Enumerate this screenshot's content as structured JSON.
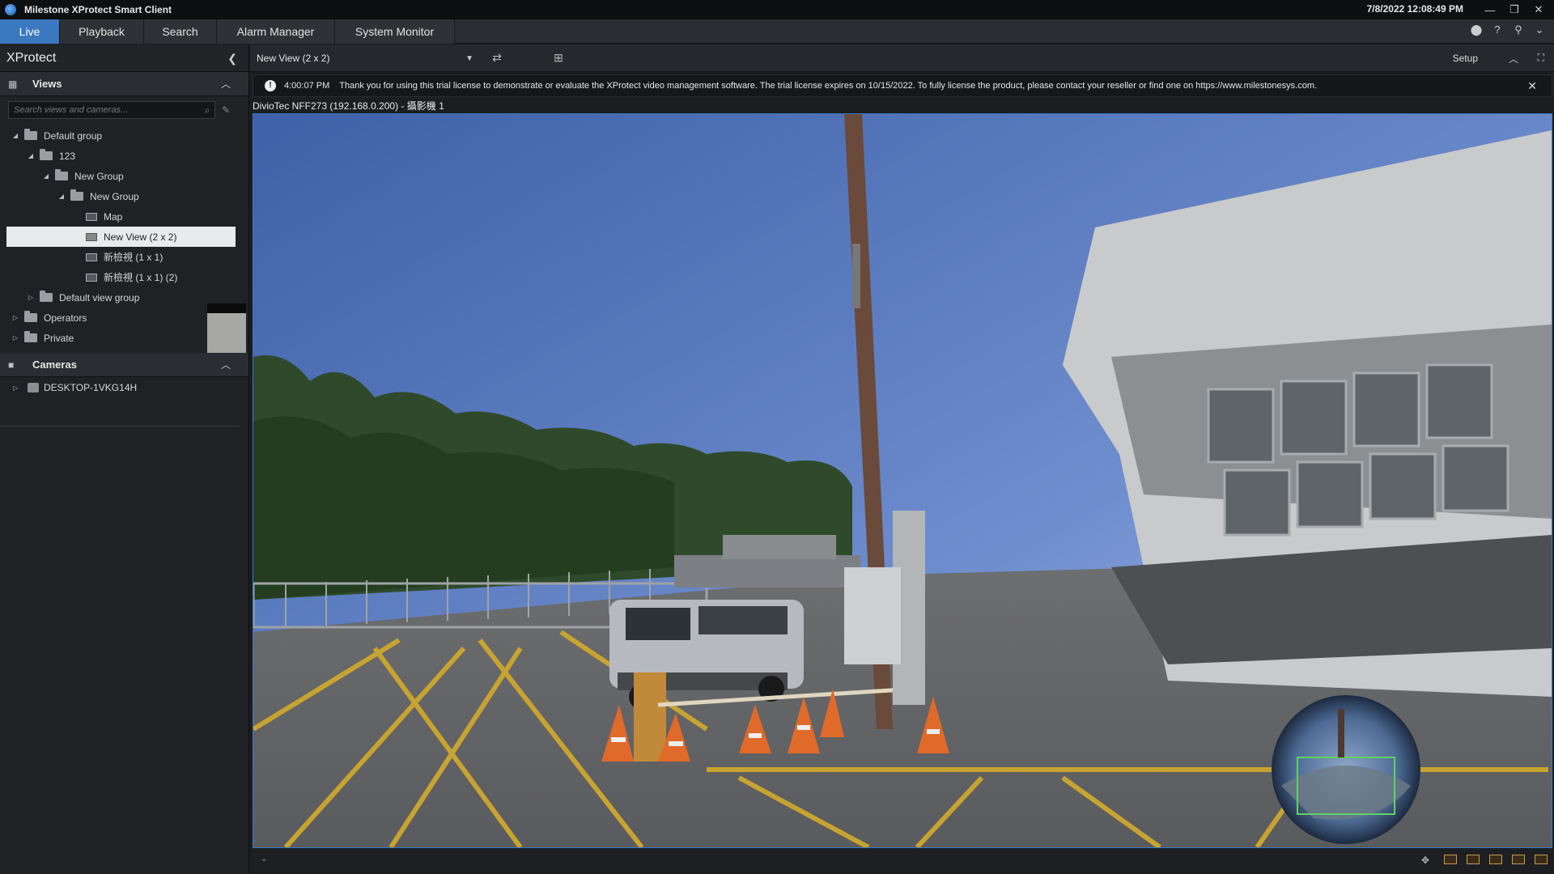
{
  "app": {
    "title": "Milestone XProtect Smart Client",
    "datetime": "7/8/2022 12:08:49 PM"
  },
  "window_controls": {
    "minimize": "—",
    "restore": "❐",
    "close": "✕"
  },
  "tabs": [
    {
      "label": "Live",
      "active": true
    },
    {
      "label": "Playback",
      "active": false
    },
    {
      "label": "Search",
      "active": false
    },
    {
      "label": "Alarm Manager",
      "active": false
    },
    {
      "label": "System Monitor",
      "active": false
    }
  ],
  "sidebar": {
    "title": "XProtect",
    "views": {
      "label": "Views",
      "search_placeholder": "Search views and cameras...",
      "tree": [
        {
          "label": "Default group",
          "type": "folder",
          "expanded": true
        },
        {
          "label": "123",
          "type": "folder",
          "expanded": true
        },
        {
          "label": "New Group",
          "type": "folder",
          "expanded": true
        },
        {
          "label": "New Group",
          "type": "folder",
          "expanded": true
        },
        {
          "label": "Map",
          "type": "view"
        },
        {
          "label": "New View (2 x 2)",
          "type": "view",
          "selected": true
        },
        {
          "label": "新檢視 (1 x 1)",
          "type": "view"
        },
        {
          "label": "新檢視 (1 x 1) (2)",
          "type": "view"
        },
        {
          "label": "Default view group",
          "type": "folder",
          "expanded": false
        },
        {
          "label": "Operators",
          "type": "folder",
          "expanded": false
        },
        {
          "label": "Private",
          "type": "folder",
          "expanded": false
        }
      ]
    },
    "cameras": {
      "label": "Cameras",
      "hosts": [
        {
          "label": "DESKTOP-1VKG14H"
        }
      ]
    }
  },
  "viewbar": {
    "current_view": "New View (2 x 2)",
    "setup_label": "Setup"
  },
  "notice": {
    "time": "4:00:07 PM",
    "text": "Thank you for using this trial license to demonstrate or evaluate the XProtect video management software. The trial license expires on 10/15/2022. To fully license the product, please contact your reseller or find one on https://www.milestonesys.com."
  },
  "camera": {
    "title": "DivioTec NFF273 (192.168.0.200) - 攝影機 1"
  },
  "colors": {
    "accent": "#3a78c0",
    "background": "#1b1d20",
    "panel": "#1f2124"
  }
}
